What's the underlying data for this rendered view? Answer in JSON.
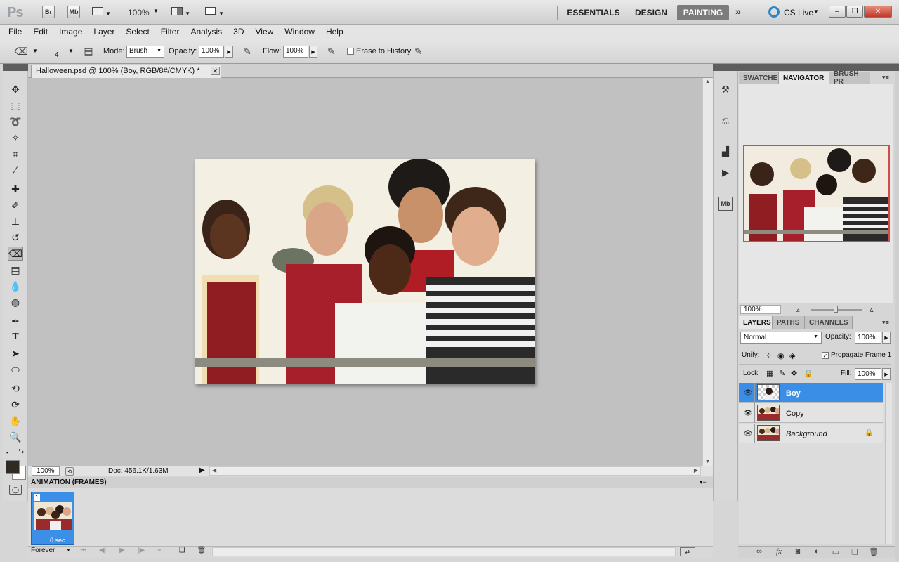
{
  "app": {
    "logo": "Ps",
    "bridge": "Br",
    "minibridge": "Mb",
    "zoom": "100%",
    "workspaces": [
      "ESSENTIALS",
      "DESIGN",
      "PAINTING"
    ],
    "cslive": "CS Live"
  },
  "menu": [
    "File",
    "Edit",
    "Image",
    "Layer",
    "Select",
    "Filter",
    "Analysis",
    "3D",
    "View",
    "Window",
    "Help"
  ],
  "options": {
    "brush_size": "4",
    "mode_label": "Mode:",
    "mode_value": "Brush",
    "opacity_label": "Opacity:",
    "opacity_value": "100%",
    "flow_label": "Flow:",
    "flow_value": "100%",
    "erase_history": "Erase to History"
  },
  "document": {
    "tab_title": "Halloween.psd @ 100% (Boy, RGB/8#/CMYK) *",
    "zoom": "100%",
    "doc_size": "Doc: 456.1K/1.63M"
  },
  "animation": {
    "title": "ANIMATION (FRAMES)",
    "frame_number": "1",
    "frame_delay": "0 sec.",
    "loop": "Forever"
  },
  "navigator": {
    "tabs": [
      "SWATCHE",
      "NAVIGATOR",
      "BRUSH PR"
    ],
    "zoom": "100%"
  },
  "layers": {
    "tabs": [
      "LAYERS",
      "PATHS",
      "CHANNELS"
    ],
    "blend_mode": "Normal",
    "opacity_label": "Opacity:",
    "opacity_value": "100%",
    "unify_label": "Unify:",
    "propagate": "Propagate Frame 1",
    "lock_label": "Lock:",
    "fill_label": "Fill:",
    "fill_value": "100%",
    "items": [
      {
        "name": "Boy",
        "selected": true
      },
      {
        "name": "Copy",
        "selected": false
      },
      {
        "name": "Background",
        "selected": false,
        "locked": true
      }
    ]
  },
  "colors": {
    "accent": "#3a8ee6",
    "painting_ws": "#7c7c7c",
    "close_btn": "#c0392b"
  }
}
